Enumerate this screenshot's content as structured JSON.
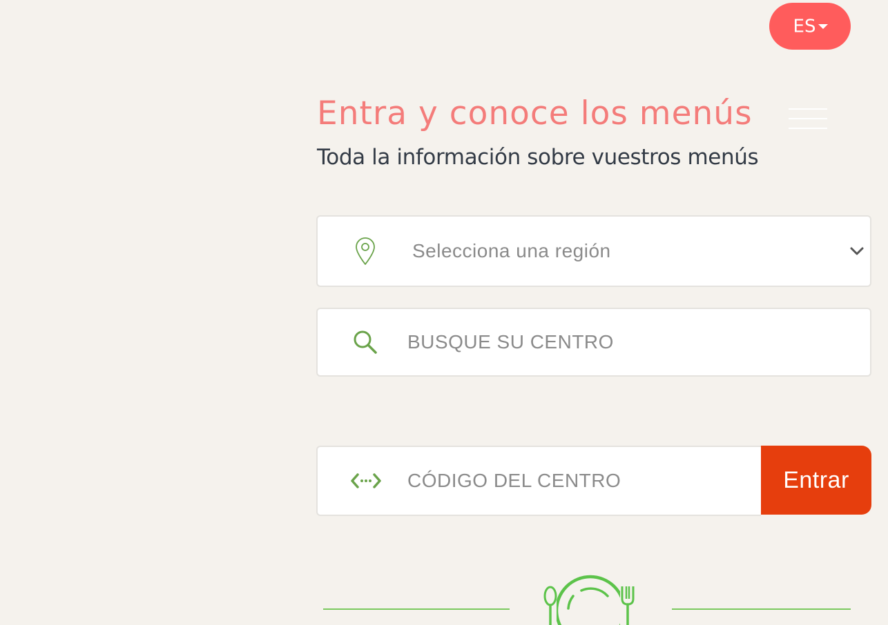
{
  "language": {
    "selected": "ES"
  },
  "header": {
    "title": "Entra y conoce los menús",
    "subtitle": "Toda la información sobre vuestros menús"
  },
  "region_select": {
    "placeholder": "Selecciona una región",
    "icon": "map-pin-icon"
  },
  "center_search": {
    "placeholder": "BUSQUE SU CENTRO",
    "icon": "search-icon"
  },
  "center_code": {
    "placeholder": "CÓDIGO DEL CENTRO",
    "icon": "code-icon",
    "button_label": "Entrar"
  },
  "footer": {
    "logo_icon": "plate-cutlery-icon"
  },
  "colors": {
    "background": "#f5f2ed",
    "language_button": "#ff5c5c",
    "title": "#f47c7a",
    "subtitle": "#333b46",
    "icon_green": "#6aa34a",
    "logo_green": "#5cc34a",
    "enter_button": "#e63e0d",
    "placeholder_text": "#8a8a8a"
  }
}
